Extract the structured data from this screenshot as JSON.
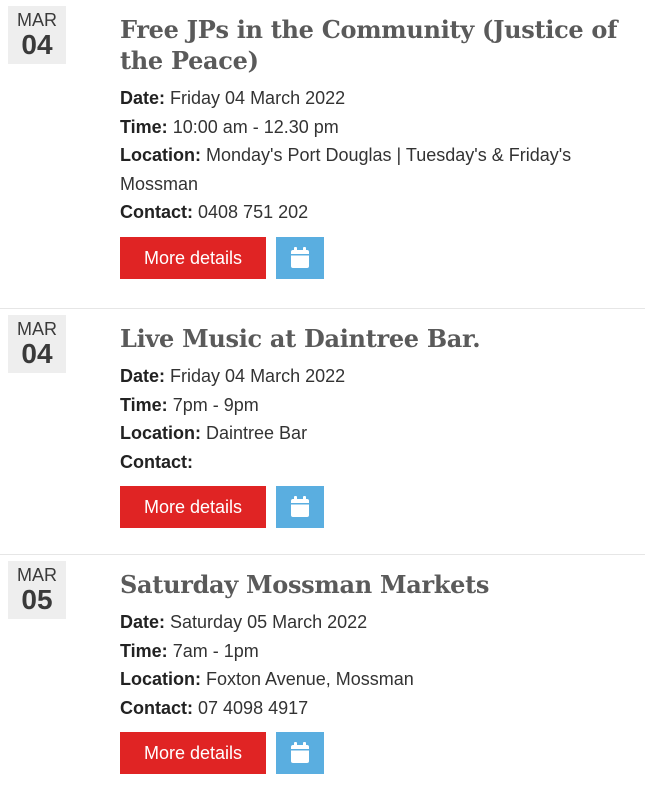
{
  "colors": {
    "more_button_bg": "#e02424",
    "calendar_button_bg": "#5aaee0",
    "date_box_bg": "#eeeeee"
  },
  "events": [
    {
      "month": "MAR",
      "day": "04",
      "title": "Free JPs in the Community (Justice of the Peace)",
      "date_label": "Date:",
      "date": "Friday 04 March 2022",
      "time_label": "Time:",
      "time": "10:00 am - 12.30 pm",
      "location_label": "Location:",
      "location": "Monday's Port Douglas | Tuesday's & Friday's Mossman",
      "contact_label": "Contact:",
      "contact": "0408 751 202",
      "more_label": "More details",
      "calendar_icon": "calendar-icon"
    },
    {
      "month": "MAR",
      "day": "04",
      "title": "Live Music at Daintree Bar.",
      "date_label": "Date:",
      "date": "Friday 04 March 2022",
      "time_label": "Time:",
      "time": "7pm - 9pm",
      "location_label": "Location:",
      "location": "Daintree Bar",
      "contact_label": "Contact:",
      "contact": "",
      "more_label": "More details",
      "calendar_icon": "calendar-icon"
    },
    {
      "month": "MAR",
      "day": "05",
      "title": "Saturday Mossman Markets",
      "date_label": "Date:",
      "date": "Saturday 05 March 2022",
      "time_label": "Time:",
      "time": "7am - 1pm",
      "location_label": "Location:",
      "location": "Foxton Avenue, Mossman",
      "contact_label": "Contact:",
      "contact": "07 4098 4917",
      "more_label": "More details",
      "calendar_icon": "calendar-icon"
    }
  ]
}
